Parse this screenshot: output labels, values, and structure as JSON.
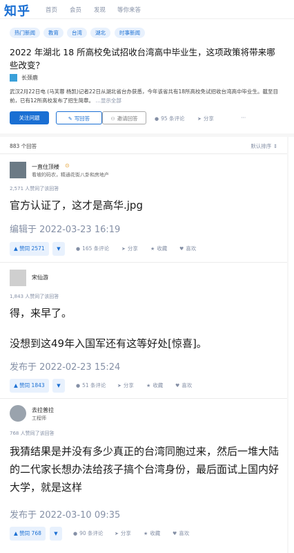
{
  "header": {
    "logo": "知乎",
    "nav": [
      "首页",
      "会员",
      "发现",
      "等你来答"
    ]
  },
  "question": {
    "tags": [
      "热门新闻",
      "教育",
      "台湾",
      "湖北",
      "时事新闻"
    ],
    "title": "2022 年湖北 18 所高校免试招收台湾高中毕业生，这项政策将带来哪些改变？",
    "asker": "长颈鹿",
    "detail": "武汉2月22日电 (马芙蓉 杨凯)记者22日从湖北省台办获悉，今年该省共有18所高校免试招收台湾高中毕业生。截至目前，已有12所高校发布了招生简章。",
    "detail_more": "…显示全部",
    "buttons": {
      "follow": "关注问题",
      "write": "写回答",
      "invite": "邀请回答"
    },
    "comments": "95 条评论",
    "share": "分享",
    "more": "···"
  },
  "answer_list": {
    "count": "883 个回答",
    "sort": "默认排序"
  },
  "answers": [
    {
      "author": "一直住顶楼",
      "bio": "看坡的码农，精通花街八卦和房地产",
      "votes_line": "2,571 人赞同了该回答",
      "content": [
        "官方认证了，这才是高华.jpg"
      ],
      "time": "编辑于 2022-03-23 16:19",
      "vote": "赞同 2571",
      "comments": "165 条评论",
      "share": "分享",
      "favorite": "收藏",
      "like": "喜欢"
    },
    {
      "author": "宋仙游",
      "bio": "",
      "votes_line": "1,843 人赞同了该回答",
      "content": [
        "得，来早了。",
        "没想到这49年入国军还有这等好处[惊喜]。"
      ],
      "time": "发布于 2022-02-23 15:24",
      "vote": "赞同 1843",
      "comments": "51 条评论",
      "share": "分享",
      "favorite": "收藏",
      "like": "喜欢"
    },
    {
      "author": "去拉普拉",
      "bio": "工程师",
      "votes_line": "768 人赞同了该回答",
      "content": [
        "我猜结果是并没有多少真正的台湾同胞过来，然后一堆大陆的二代家长想办法给孩子搞个台湾身份，最后面试上国内好大学，就是这样"
      ],
      "time": "发布于 2022-03-10 09:35",
      "vote": "赞同 768",
      "comments": "90 条评论",
      "share": "分享",
      "favorite": "收藏",
      "like": "喜欢"
    }
  ],
  "colors": {
    "brand": "#1a6fd3",
    "muted": "#8590a6",
    "vote_bg": "#e8f1fd"
  }
}
